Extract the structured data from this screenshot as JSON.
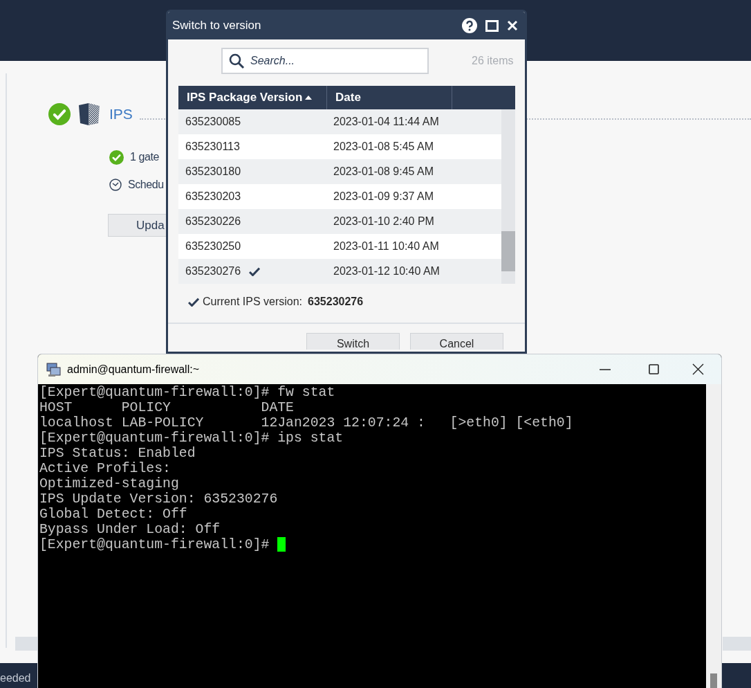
{
  "background": {
    "section": {
      "title": "IPS",
      "verified": true
    },
    "details": [
      {
        "kind": "ok",
        "text": "1 gate"
      },
      {
        "kind": "schedule",
        "text": "Schedu"
      }
    ],
    "button": "Upda",
    "status_bar": "eeded"
  },
  "dialog": {
    "title": "Switch to version",
    "search": {
      "placeholder": "Search..."
    },
    "count": "26 items",
    "columns": [
      {
        "label": "IPS Package Version",
        "sorted": true
      },
      {
        "label": "Date",
        "sorted": false
      }
    ],
    "rows": [
      {
        "version": "635230085",
        "date": "2023-01-04 11:44 AM",
        "current": false
      },
      {
        "version": "635230113",
        "date": "2023-01-08 5:45 AM",
        "current": false
      },
      {
        "version": "635230180",
        "date": "2023-01-08 9:45 AM",
        "current": false
      },
      {
        "version": "635230203",
        "date": "2023-01-09 9:37 AM",
        "current": false
      },
      {
        "version": "635230226",
        "date": "2023-01-10 2:40 PM",
        "current": false
      },
      {
        "version": "635230250",
        "date": "2023-01-11 10:40 AM",
        "current": false
      },
      {
        "version": "635230276",
        "date": "2023-01-12 10:40 AM",
        "current": true
      }
    ],
    "current_label": "Current IPS version:",
    "current_value": "635230276",
    "buttons": [
      "Switch",
      "Cancel"
    ]
  },
  "terminal": {
    "title": "admin@quantum-firewall:~",
    "cursor": true,
    "lines": [
      "[Expert@quantum-firewall:0]# fw stat",
      "HOST      POLICY           DATE",
      "localhost LAB-POLICY       12Jan2023 12:07:24 :   [>eth0] [<eth0]",
      "[Expert@quantum-firewall:0]# ips stat",
      "IPS Status: Enabled",
      "Active Profiles:",
      "Optimized-staging",
      "IPS Update Version: 635230276",
      "Global Detect: Off",
      "Bypass Under Load: Off",
      "[Expert@quantum-firewall:0]# "
    ]
  }
}
